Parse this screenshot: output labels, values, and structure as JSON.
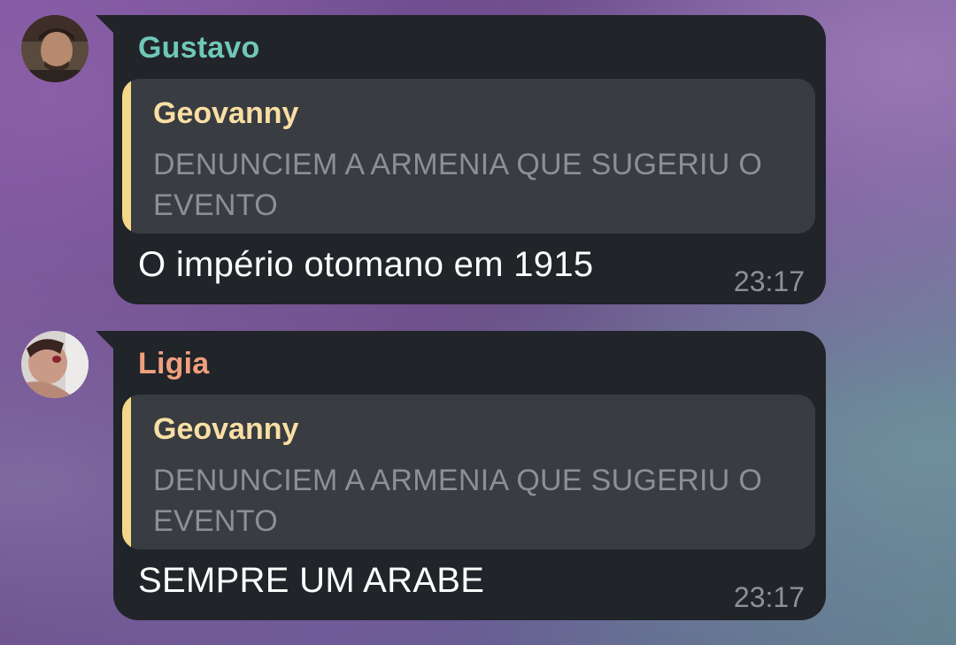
{
  "chat": {
    "messages": [
      {
        "sender": "Gustavo",
        "sender_color": "#6fc7b8",
        "reply": {
          "name": "Geovanny",
          "text": "DENUNCIEM A ARMENIA QUE SUGERIU O EVENTO"
        },
        "text": "O império otomano em 1915",
        "time": "23:17"
      },
      {
        "sender": "Ligia",
        "sender_color": "#f0a07e",
        "reply": {
          "name": "Geovanny",
          "text": "DENUNCIEM A ARMENIA QUE SUGERIU O EVENTO"
        },
        "text": "SEMPRE UM ARABE",
        "time": "23:17"
      }
    ]
  },
  "theme": {
    "bubble_bg": "#212429",
    "reply_bg": "#393c41",
    "reply_bar": "#f5d78a",
    "reply_name": "#f9dfa4"
  }
}
